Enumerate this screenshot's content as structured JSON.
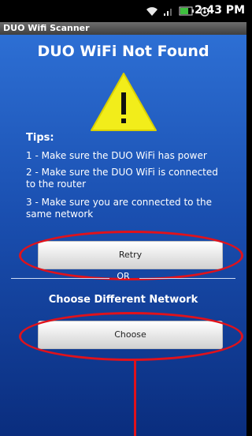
{
  "status_bar": {
    "time": "2:43 PM",
    "icons": [
      "wifi-icon",
      "signal-icon",
      "battery-icon",
      "alarm-icon"
    ]
  },
  "app": {
    "title": "DUO Wifi Scanner"
  },
  "main": {
    "heading": "DUO WiFi Not Found",
    "warning_icon": "warning-icon",
    "tips_label": "Tips:",
    "tips": [
      "1 - Make sure the DUO WiFi has power",
      "2 - Make sure the DUO WiFi is connected to the router",
      "3 - Make sure you are connected to the same network"
    ],
    "retry_label": "Retry",
    "or_label": "OR",
    "choose_heading": "Choose Different Network",
    "choose_label": "Choose"
  },
  "colors": {
    "highlight": "#e0121b",
    "background_top": "#2d6fd4",
    "background_bottom": "#0a2d7e"
  }
}
